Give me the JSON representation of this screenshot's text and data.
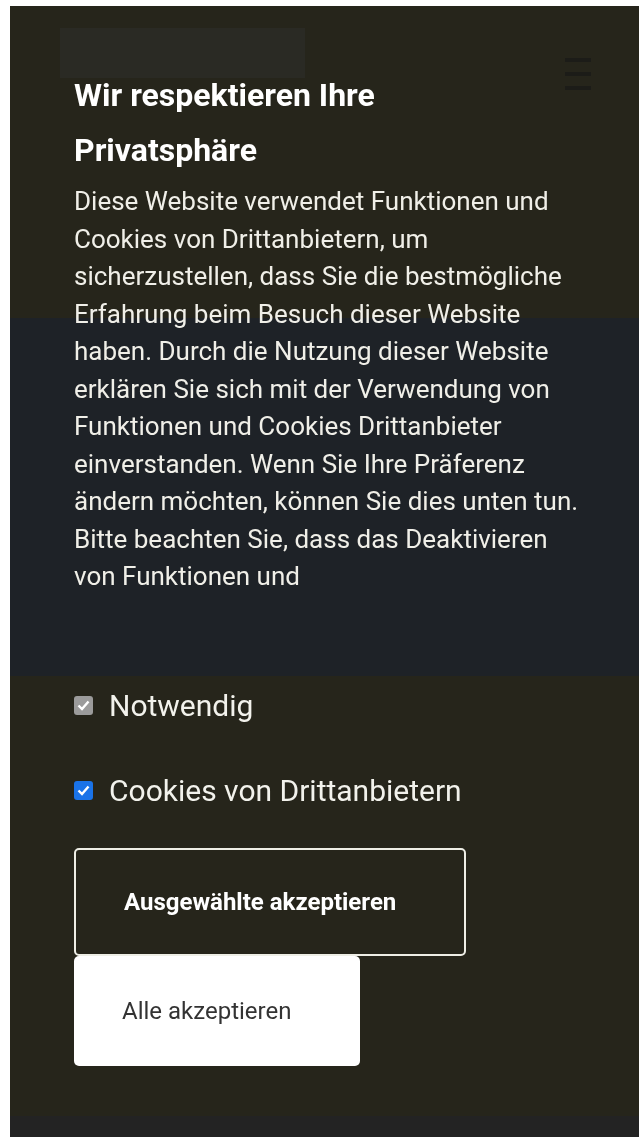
{
  "dialog": {
    "title": "Wir respektieren Ihre Privatsphäre",
    "body": "Diese Website verwendet Funktionen und Cookies von Drittanbietern, um sicherzustellen, dass Sie die bestmögliche Erfahrung beim Besuch dieser Website haben. Durch die Nutzung dieser Website erklären Sie sich mit der Verwendung von Funktionen und Cookies Drittanbieter einverstanden. Wenn Sie Ihre Präferenz ändern möchten, können Sie dies unten tun. Bitte beachten Sie, dass das Deaktivieren von Funktionen und",
    "options": [
      {
        "label": "Notwendig",
        "checked": true,
        "disabled": true
      },
      {
        "label": "Cookies von Drittanbietern",
        "checked": true,
        "disabled": false
      }
    ],
    "buttons": [
      {
        "label": "Ausgewählte akzeptieren",
        "kind": "outline"
      },
      {
        "label": "Alle akzeptieren",
        "kind": "solid"
      }
    ]
  }
}
